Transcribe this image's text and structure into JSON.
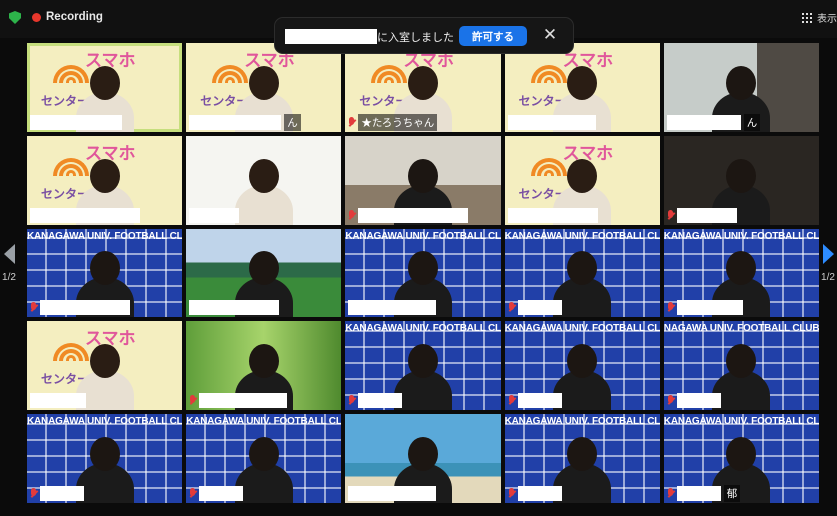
{
  "top_bar": {
    "recording_label": "Recording",
    "view_label": "表示"
  },
  "notification": {
    "message": "に入室しました",
    "allow_label": "許可する",
    "close_glyph": "✕"
  },
  "pagination": {
    "left_label": "1/2",
    "right_label": "1/2"
  },
  "branding": {
    "smaho_title": "スマホ",
    "smaho_subtitle": "センター",
    "football_banner": "KANAGAWA UNIV. FOOTBALL CLUB",
    "football_banner_cut": "NAGAWA UNIV. FOOTBALL CLUB"
  },
  "participants": [
    {
      "bg": "smaho",
      "active": true,
      "muted": false,
      "redact_w": 92,
      "name": ""
    },
    {
      "bg": "smaho",
      "active": false,
      "muted": false,
      "redact_w": 92,
      "name": "ん"
    },
    {
      "bg": "smaho",
      "active": false,
      "muted": true,
      "redact_w": 0,
      "name": "★たろうちゃん"
    },
    {
      "bg": "smaho",
      "active": false,
      "muted": false,
      "redact_w": 88,
      "name": ""
    },
    {
      "bg": "window",
      "active": false,
      "muted": false,
      "redact_w": 74,
      "name": "ん"
    },
    {
      "bg": "smaho",
      "active": false,
      "muted": false,
      "redact_w": 110,
      "name": ""
    },
    {
      "bg": "white",
      "active": false,
      "muted": false,
      "redact_w": 50,
      "name": ""
    },
    {
      "bg": "room",
      "active": false,
      "muted": true,
      "redact_w": 110,
      "name": ""
    },
    {
      "bg": "smaho",
      "active": false,
      "muted": false,
      "redact_w": 90,
      "name": ""
    },
    {
      "bg": "dark",
      "active": false,
      "muted": true,
      "redact_w": 60,
      "name": ""
    },
    {
      "bg": "football",
      "active": false,
      "muted": true,
      "redact_w": 90,
      "name": ""
    },
    {
      "bg": "stadium",
      "active": false,
      "muted": false,
      "redact_w": 90,
      "name": ""
    },
    {
      "bg": "football",
      "active": false,
      "muted": false,
      "redact_w": 88,
      "name": ""
    },
    {
      "bg": "football",
      "active": false,
      "muted": true,
      "redact_w": 44,
      "name": ""
    },
    {
      "bg": "football",
      "active": false,
      "muted": true,
      "redact_w": 66,
      "name": ""
    },
    {
      "bg": "smaho",
      "active": false,
      "muted": false,
      "redact_w": 56,
      "name": ""
    },
    {
      "bg": "grass",
      "active": false,
      "muted": true,
      "redact_w": 88,
      "name": ""
    },
    {
      "bg": "football",
      "active": false,
      "muted": true,
      "redact_w": 44,
      "name": ""
    },
    {
      "bg": "football",
      "active": false,
      "muted": true,
      "redact_w": 44,
      "name": ""
    },
    {
      "bg": "football-cut",
      "active": false,
      "muted": true,
      "redact_w": 44,
      "name": ""
    },
    {
      "bg": "football",
      "active": false,
      "muted": true,
      "redact_w": 44,
      "name": ""
    },
    {
      "bg": "football",
      "active": false,
      "muted": true,
      "redact_w": 44,
      "name": ""
    },
    {
      "bg": "beach",
      "active": false,
      "muted": false,
      "redact_w": 88,
      "name": ""
    },
    {
      "bg": "football",
      "active": false,
      "muted": true,
      "redact_w": 44,
      "name": ""
    },
    {
      "bg": "football",
      "active": false,
      "muted": true,
      "redact_w": 44,
      "name": "郁"
    }
  ]
}
